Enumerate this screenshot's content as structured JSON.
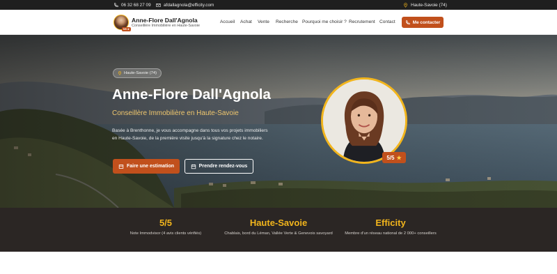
{
  "topbar": {
    "phone": "06 32 68 27 09",
    "email": "afdallagnola@efficity.com",
    "location": "Haute-Savoie (74)"
  },
  "brand": {
    "name": "Anne-Flore Dall'Agnola",
    "subtitle": "Conseillère Immobilière en Haute-Savoie",
    "avatar_badge": "5/5 ★"
  },
  "nav": {
    "links": [
      "Accueil",
      "Achat",
      "Vente",
      "Recherche",
      "Pourquoi me choisir ?",
      "Recrutement",
      "Contact"
    ],
    "cta": "Me contacter"
  },
  "hero": {
    "location_pill": "Haute-Savoie (74)",
    "title": "Anne-Flore Dall'Agnola",
    "subtitle": "Conseillère Immobilière en Haute-Savoie",
    "description": "Basée à Brenthonne, je vous accompagne dans tous vos projets immobiliers en Haute-Savoie, de la première visite jusqu'à la signature chez le notaire.",
    "primary_button": "Faire une estimation",
    "secondary_button": "Prendre rendez-vous",
    "rating_badge": "5/5"
  },
  "stats": [
    {
      "value": "5/5",
      "label": "Note Immodvisor (4 avis clients vérifiés)"
    },
    {
      "value": "Haute-Savoie",
      "label": "Chablais, bord du Léman, Vallée Verte & Genevois savoyard"
    },
    {
      "value": "Efficity",
      "label": "Membre d'un réseau national de 2 000+ conseillers"
    }
  ],
  "colors": {
    "accent": "#c1501c",
    "gold": "#f2b51c",
    "dark": "#2b2624",
    "topbar": "#1f1f1f"
  },
  "icons": {
    "phone": "phone-icon",
    "email": "mail-icon",
    "location": "map-pin-icon",
    "estimate": "home-icon",
    "appointment": "calendar-icon"
  }
}
